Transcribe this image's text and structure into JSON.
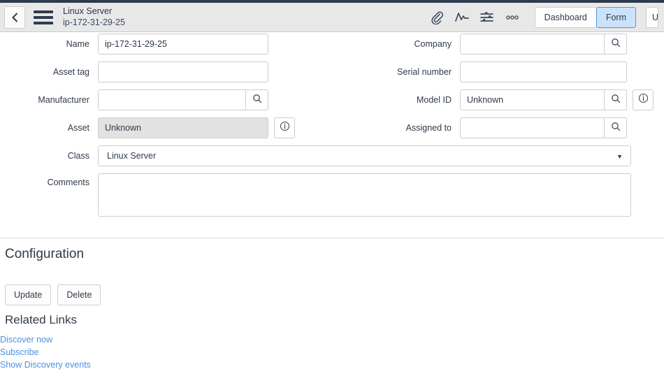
{
  "header": {
    "back_icon": "chevron-left-icon",
    "menu_icon": "hamburger-menu-icon",
    "title": "Linux Server",
    "subtitle": "ip-172-31-29-25",
    "icons": [
      {
        "name": "attachment-paperclip-icon"
      },
      {
        "name": "activity-pulse-icon"
      },
      {
        "name": "sliders-settings-icon"
      },
      {
        "name": "more-options-icon"
      }
    ],
    "buttons": {
      "dashboard": "Dashboard",
      "form": "Form",
      "update_partial": "U"
    },
    "active_button": "Form",
    "accent_color": "#4e9bdf",
    "active_bg": "#cbe3fa",
    "bg_color": "#e8e8e8",
    "strip_color": "#2e3b4e"
  },
  "form": {
    "left": [
      {
        "label": "Name",
        "value": "ip-172-31-29-25",
        "placeholder": "",
        "type": "text",
        "readonly": false,
        "lookup": false,
        "info": false
      },
      {
        "label": "Asset tag",
        "value": "",
        "placeholder": "",
        "type": "text",
        "readonly": false,
        "lookup": false,
        "info": false
      },
      {
        "label": "Manufacturer",
        "value": "",
        "placeholder": "",
        "type": "reference",
        "readonly": false,
        "lookup": true,
        "info": false
      },
      {
        "label": "Asset",
        "value": "Unknown",
        "placeholder": "",
        "type": "text",
        "readonly": true,
        "lookup": false,
        "info": true
      }
    ],
    "right": [
      {
        "label": "Company",
        "value": "",
        "placeholder": "",
        "type": "reference",
        "readonly": false,
        "lookup": true,
        "info": false
      },
      {
        "label": "Serial number",
        "value": "",
        "placeholder": "",
        "type": "text",
        "readonly": false,
        "lookup": false,
        "info": false
      },
      {
        "label": "Model ID",
        "value": "Unknown",
        "placeholder": "",
        "type": "reference",
        "readonly": false,
        "lookup": true,
        "info": true
      },
      {
        "label": "Assigned to",
        "value": "",
        "placeholder": "",
        "type": "reference",
        "readonly": false,
        "lookup": true,
        "info": false
      }
    ],
    "class_field": {
      "label": "Class",
      "value": "Linux Server",
      "caret": "▼"
    },
    "comments_field": {
      "label": "Comments",
      "value": "",
      "placeholder": ""
    },
    "lookup_icon": "search-magnifier-icon",
    "info_icon": "info-circle-icon"
  },
  "configuration": {
    "heading": "Configuration",
    "buttons": [
      {
        "label": "Update",
        "name": "update-button"
      },
      {
        "label": "Delete",
        "name": "delete-button"
      }
    ]
  },
  "related_links": {
    "heading": "Related Links",
    "link_color": "#4a90e2",
    "items": [
      {
        "label": "Discover now"
      },
      {
        "label": "Subscribe"
      },
      {
        "label": "Show Discovery events"
      }
    ]
  }
}
